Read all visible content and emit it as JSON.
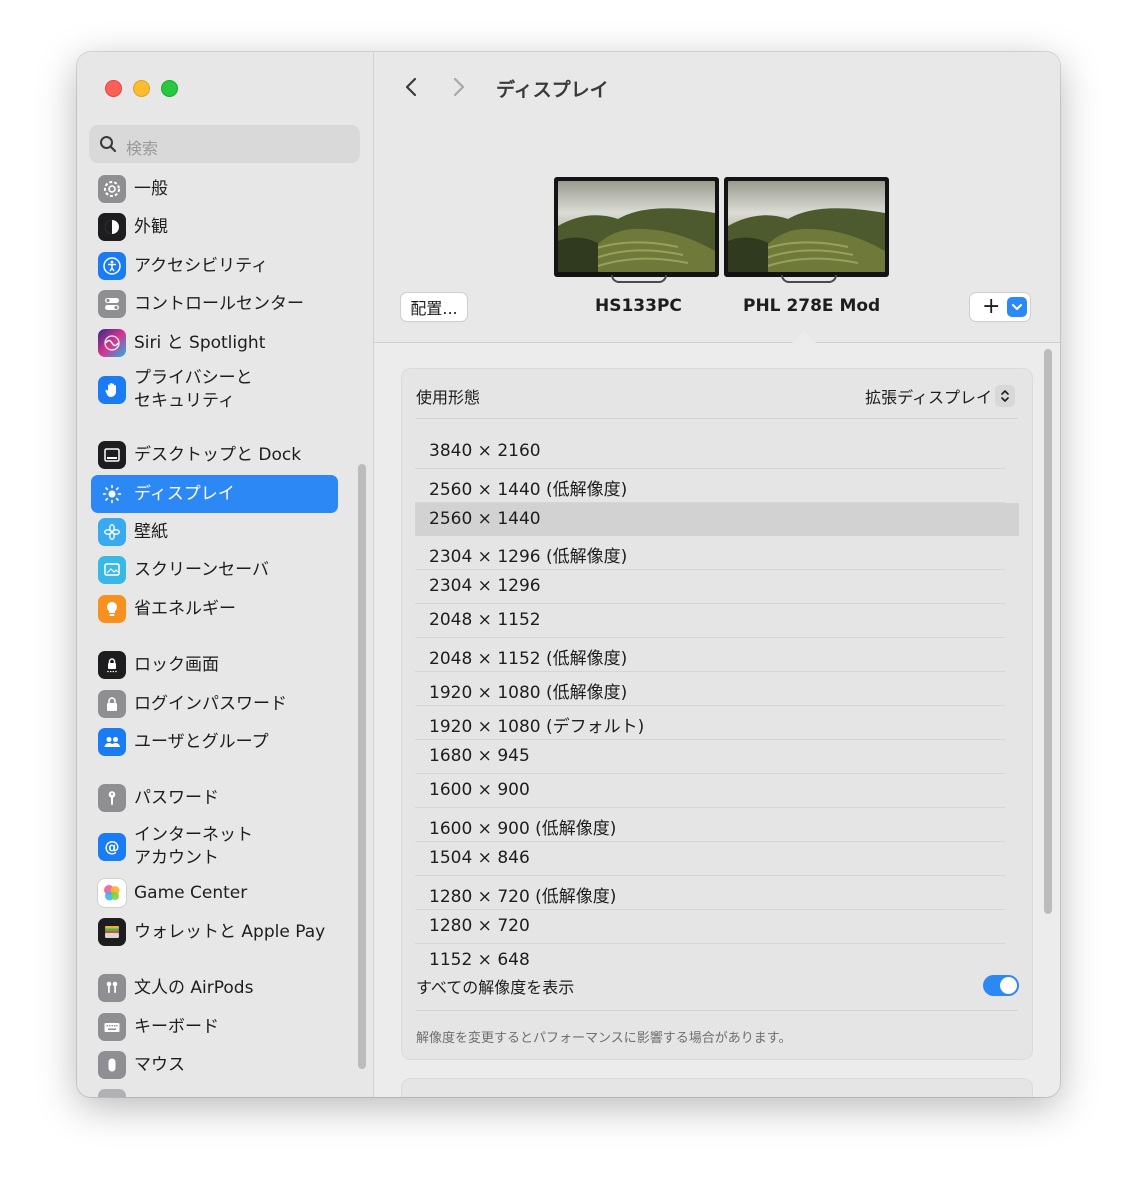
{
  "window": {
    "title": "ディスプレイ"
  },
  "search": {
    "placeholder": "検索"
  },
  "sidebar": {
    "items": [
      {
        "label": "一般",
        "icon": "gear-icon",
        "color": "#8e8e93"
      },
      {
        "label": "外観",
        "icon": "appearance-icon",
        "color": "#1d1d1f"
      },
      {
        "label": "アクセシビリティ",
        "icon": "accessibility-icon",
        "color": "#1a7cf5"
      },
      {
        "label": "コントロールセンター",
        "icon": "control-center-icon",
        "color": "#8e8e93"
      },
      {
        "label": "Siri と Spotlight",
        "icon": "siri-icon",
        "color": "#7a3ce0"
      },
      {
        "label": "プライバシーと",
        "label2": "セキュリティ",
        "icon": "hand-icon",
        "color": "#1a7cf5"
      },
      {
        "label": "デスクトップと Dock",
        "icon": "dock-icon",
        "color": "#1d1d1f"
      },
      {
        "label": "ディスプレイ",
        "icon": "display-brightness-icon",
        "color": "#2b88f4"
      },
      {
        "label": "壁紙",
        "icon": "wallpaper-icon",
        "color": "#39a9f0"
      },
      {
        "label": "スクリーンセーバ",
        "icon": "screensaver-icon",
        "color": "#39b8e8"
      },
      {
        "label": "省エネルギー",
        "icon": "battery-bulb-icon",
        "color": "#f7901e"
      },
      {
        "label": "ロック画面",
        "icon": "lock-screen-icon",
        "color": "#1d1d1f"
      },
      {
        "label": "ログインパスワード",
        "icon": "lock-icon",
        "color": "#8e8e93"
      },
      {
        "label": "ユーザとグループ",
        "icon": "users-icon",
        "color": "#1a7cf5"
      },
      {
        "label": "パスワード",
        "icon": "key-icon",
        "color": "#8e8e93"
      },
      {
        "label": "インターネット",
        "label2": "アカウント",
        "icon": "at-icon",
        "color": "#1a7cf5"
      },
      {
        "label": "Game Center",
        "icon": "game-center-icon",
        "color": "#ffffff"
      },
      {
        "label": "ウォレットと Apple Pay",
        "icon": "wallet-icon",
        "color": "#1d1d1f"
      },
      {
        "label": "文人の AirPods",
        "icon": "airpods-icon",
        "color": "#8e8e93"
      },
      {
        "label": "キーボード",
        "icon": "keyboard-icon",
        "color": "#8e8e93"
      },
      {
        "label": "マウス",
        "icon": "mouse-icon",
        "color": "#8e8e93"
      }
    ],
    "selected": "ディスプレイ"
  },
  "displays": {
    "arrange_label": "配置...",
    "monitors": [
      {
        "name": "HS133PC"
      },
      {
        "name": "PHL 278E Mod"
      }
    ],
    "add_label": "+"
  },
  "settings": {
    "usage_label": "使用形態",
    "usage_value": "拡張ディスプレイ",
    "resolutions": [
      "3840 × 2160",
      "2560 × 1440 (低解像度)",
      "2560 × 1440",
      "2304 × 1296 (低解像度)",
      "2304 × 1296",
      "2048 × 1152",
      "2048 × 1152 (低解像度)",
      "1920 × 1080 (低解像度)",
      "1920 × 1080 (デフォルト)",
      "1680 × 945",
      "1600 × 900",
      "1600 × 900 (低解像度)",
      "1504 × 846",
      "1280 × 720 (低解像度)",
      "1280 × 720",
      "1152 × 648"
    ],
    "selected_resolution": "2560 × 1440",
    "show_all_label": "すべての解像度を表示",
    "show_all_on": true,
    "note": "解像度を変更するとパフォーマンスに影響する場合があります。"
  },
  "colors": {
    "accent": "#2b88f4",
    "close": "#ff5f57",
    "minimize": "#febc2e",
    "maximize": "#28c840"
  }
}
